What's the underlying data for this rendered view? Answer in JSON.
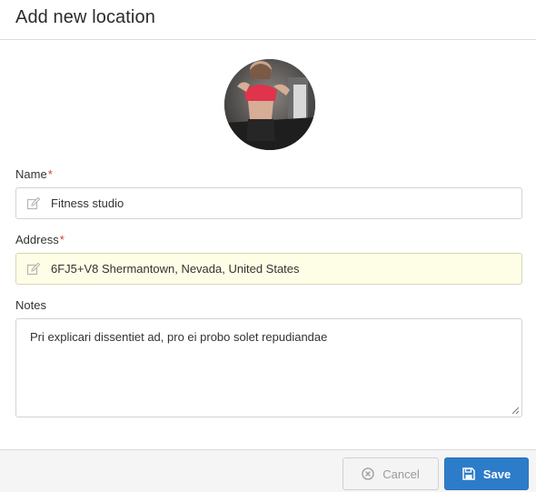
{
  "dialog": {
    "title": "Add new location"
  },
  "form": {
    "avatar_icon": "location-photo",
    "name": {
      "label": "Name",
      "required_mark": "*",
      "value": "Fitness studio",
      "icon": "edit-icon"
    },
    "address": {
      "label": "Address",
      "required_mark": "*",
      "value": "6FJ5+V8 Shermantown, Nevada, United States",
      "icon": "edit-icon"
    },
    "notes": {
      "label": "Notes",
      "value": "Pri explicari dissentiet ad, pro ei probo solet repudiandae"
    }
  },
  "footer": {
    "cancel_label": "Cancel",
    "cancel_icon": "cancel-circle-icon",
    "save_label": "Save",
    "save_icon": "save-icon"
  },
  "colors": {
    "accent": "#2d7cc9",
    "required": "#d9383a",
    "address_highlight": "#fefee6"
  }
}
